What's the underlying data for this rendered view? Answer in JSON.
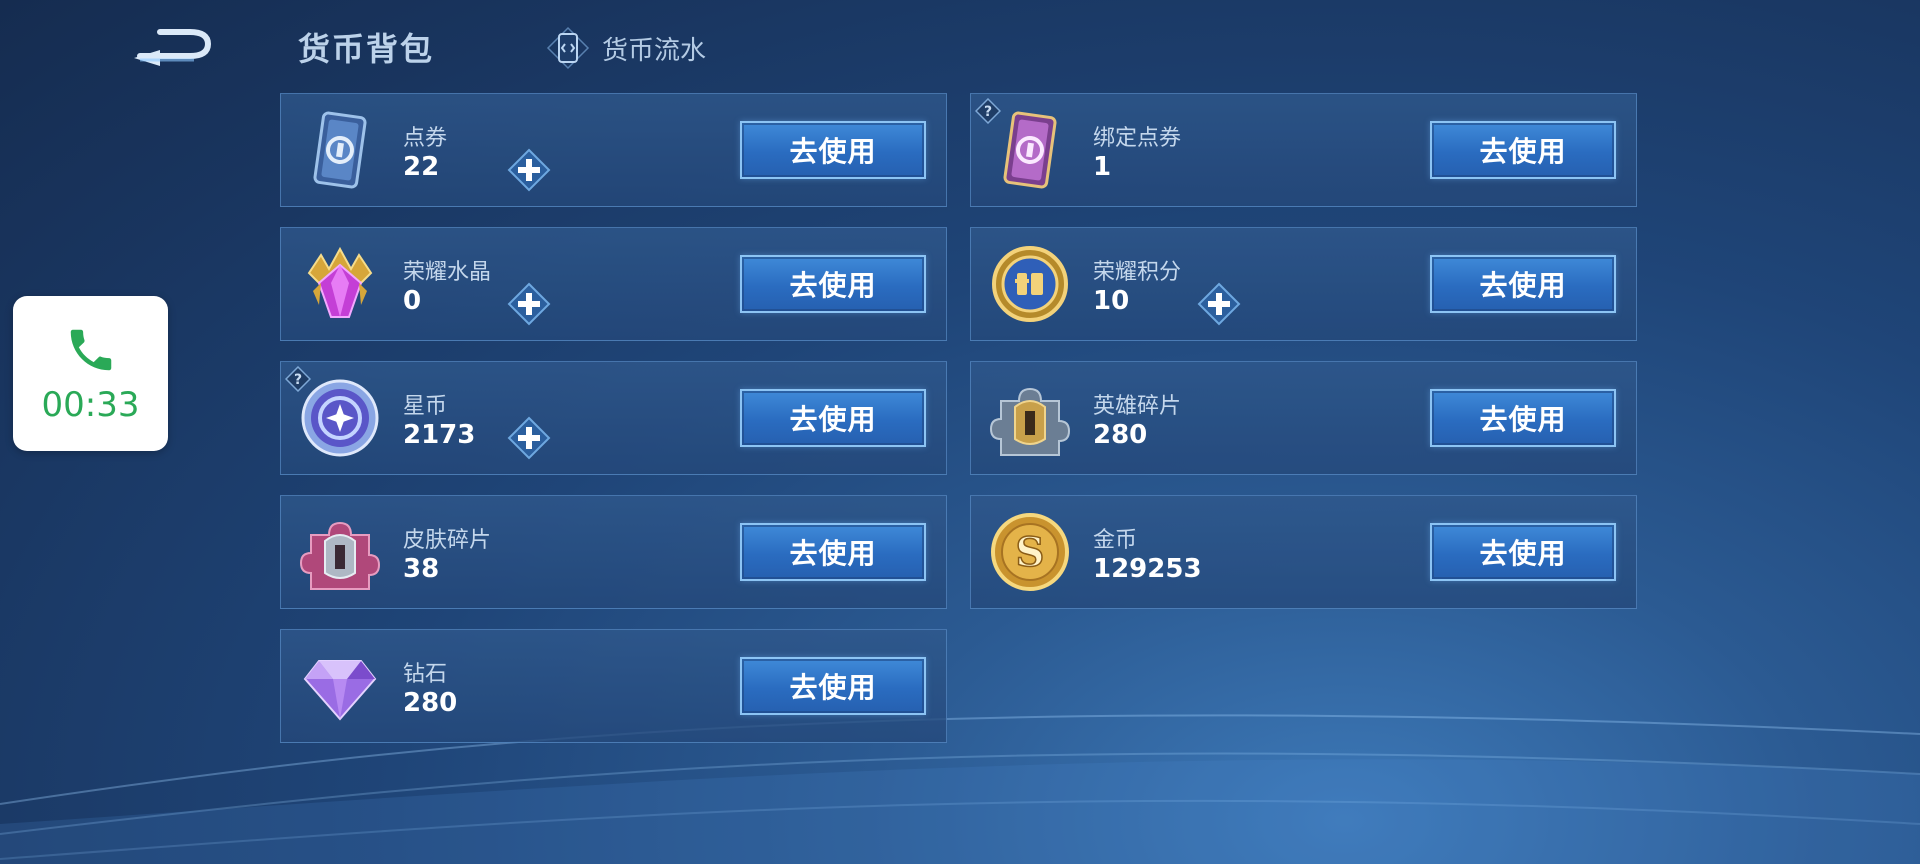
{
  "header": {
    "title": "货币背包",
    "flow_tab_label": "货币流水"
  },
  "call_widget": {
    "duration": "00:33",
    "accent_color": "#2aa957"
  },
  "use_button_label": "去使用",
  "currencies": [
    {
      "name": "点券",
      "amount": "22",
      "icon": "coupon-card-icon",
      "has_plus": true,
      "has_help": false
    },
    {
      "name": "绑定点券",
      "amount": "1",
      "icon": "bound-coupon-card-icon",
      "has_plus": false,
      "has_help": true
    },
    {
      "name": "荣耀水晶",
      "amount": "0",
      "icon": "glory-crystal-icon",
      "has_plus": true,
      "has_help": false
    },
    {
      "name": "荣耀积分",
      "amount": "10",
      "icon": "glory-points-icon",
      "has_plus": true,
      "has_help": false
    },
    {
      "name": "星币",
      "amount": "2173",
      "icon": "star-coin-icon",
      "has_plus": true,
      "has_help": true
    },
    {
      "name": "英雄碎片",
      "amount": "280",
      "icon": "hero-fragment-icon",
      "has_plus": false,
      "has_help": false
    },
    {
      "name": "皮肤碎片",
      "amount": "38",
      "icon": "skin-fragment-icon",
      "has_plus": false,
      "has_help": false
    },
    {
      "name": "金币",
      "amount": "129253",
      "icon": "gold-coin-icon",
      "has_plus": false,
      "has_help": false
    },
    {
      "name": "钻石",
      "amount": "280",
      "icon": "diamond-icon",
      "has_plus": false,
      "has_help": false
    }
  ],
  "colors": {
    "background": "#1f4578",
    "button": "#2a6cc0",
    "button_border": "#8cc4f4"
  }
}
